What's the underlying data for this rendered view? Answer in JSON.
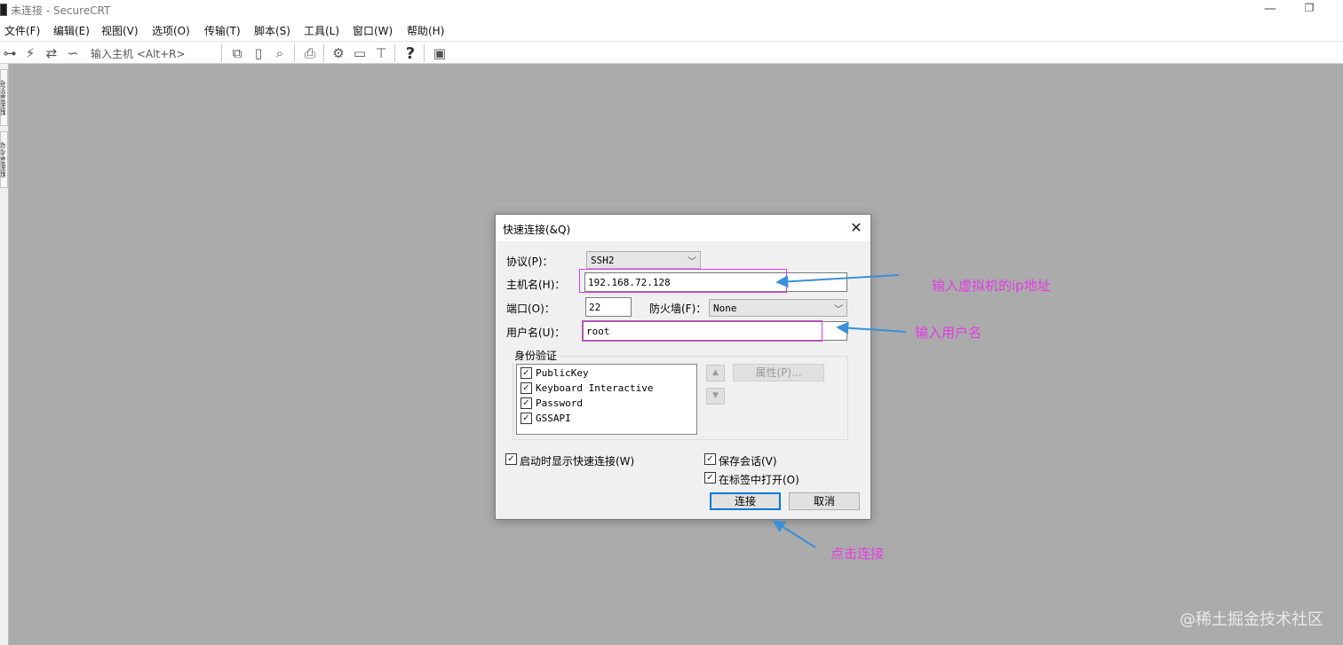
{
  "window": {
    "title": "未连接 - SecureCRT"
  },
  "menu": [
    "文件(F)",
    "编辑(E)",
    "视图(V)",
    "选项(O)",
    "传输(T)",
    "脚本(S)",
    "工具(L)",
    "窗口(W)",
    "帮助(H)"
  ],
  "toolbar": {
    "host_placeholder": "输入主机 <Alt+R>",
    "icons": [
      "connect-tree-icon",
      "lightning-icon",
      "reconnect-icon",
      "disconnect-icon",
      "copy-icon",
      "paste-icon",
      "find-icon",
      "print-icon",
      "settings-icon",
      "session-options-icon",
      "keymap-icon",
      "help-icon",
      "sftp-icon"
    ]
  },
  "sidebar": {
    "tabs": [
      "会话管理器",
      "命令管理器"
    ]
  },
  "dialog": {
    "title": "快速连接(&Q)",
    "protocol_label": "协议(P)：",
    "protocol_value": "SSH2",
    "hostname_label": "主机名(H)：",
    "hostname_value": "192.168.72.128",
    "port_label": "端口(O)：",
    "port_value": "22",
    "firewall_label": "防火墙(F)：",
    "firewall_value": "None",
    "username_label": "用户名(U)：",
    "username_value": "root",
    "auth_group_label": "身份验证",
    "auth_methods": [
      {
        "label": "PublicKey",
        "checked": true
      },
      {
        "label": "Keyboard Interactive",
        "checked": true
      },
      {
        "label": "Password",
        "checked": true
      },
      {
        "label": "GSSAPI",
        "checked": true
      }
    ],
    "properties_button": "属性(P)...",
    "show_on_startup": {
      "label": "启动时显示快速连接(W)",
      "checked": true
    },
    "save_session": {
      "label": "保存会话(V)",
      "checked": true
    },
    "open_in_tab": {
      "label": "在标签中打开(O)",
      "checked": true
    },
    "connect_button": "连接",
    "cancel_button": "取消"
  },
  "annotations": {
    "ip_note": "输入虚拟机的ip地址",
    "user_note": "输入用户名",
    "connect_note": "点击连接",
    "color": "#e33be6",
    "arrow_color": "#3a8fd8"
  },
  "watermark": "@稀土掘金技术社区"
}
